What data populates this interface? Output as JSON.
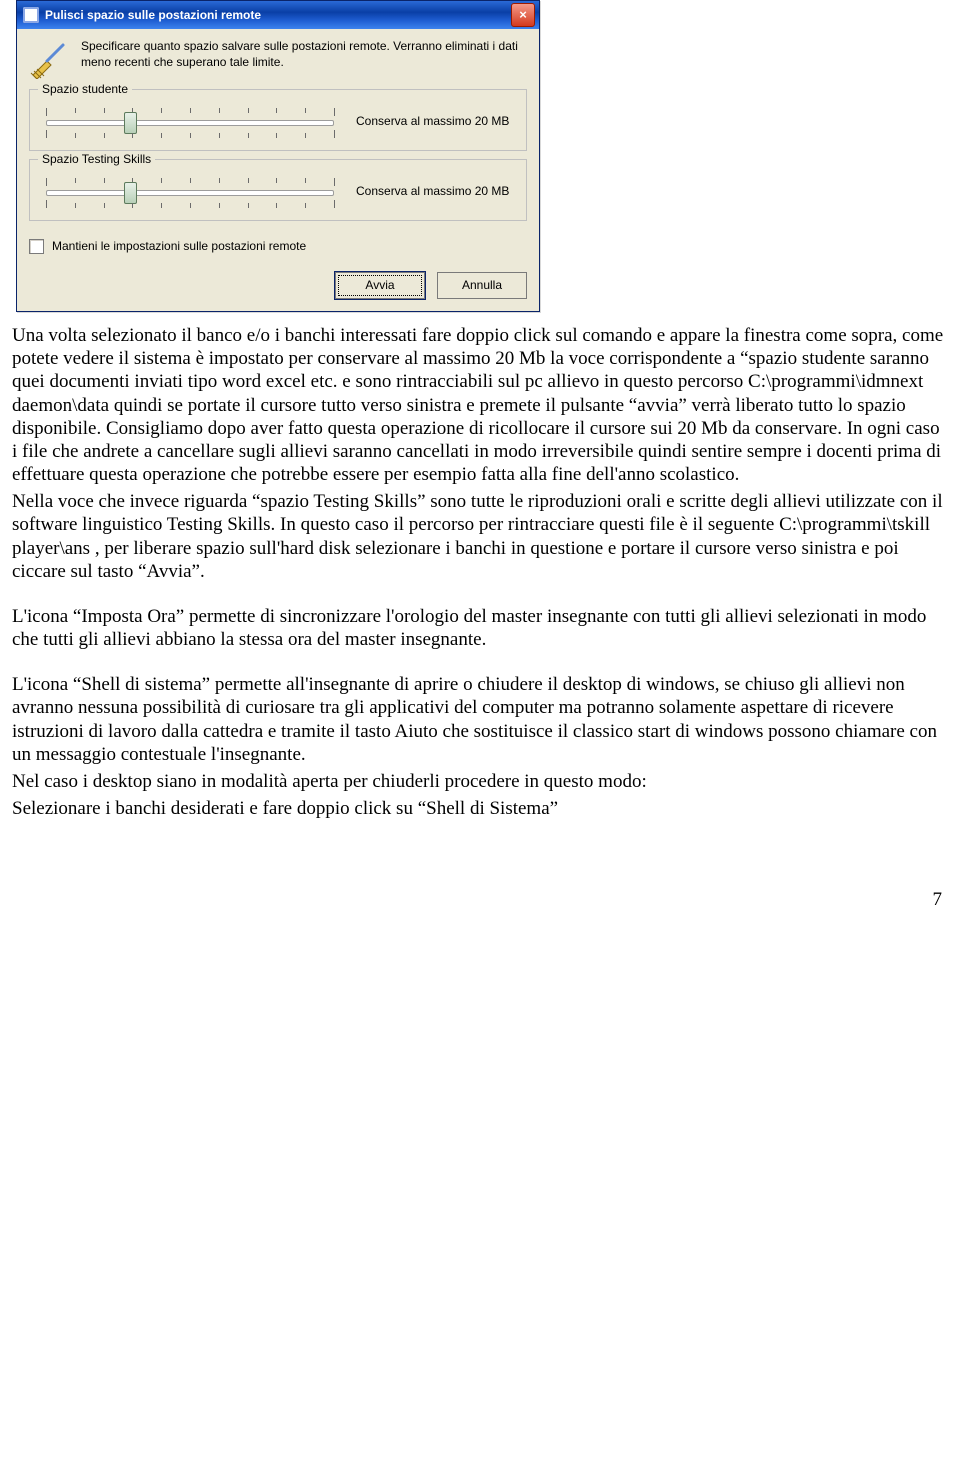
{
  "dialog": {
    "title": "Pulisci spazio sulle postazioni remote",
    "close": "×",
    "intro": "Specificare quanto spazio salvare sulle postazioni remote. Verranno eliminati i dati meno recenti che superano tale limite.",
    "group1": {
      "legend": "Spazio studente",
      "value_text": "Conserva al massimo 20 MB"
    },
    "group2": {
      "legend": "Spazio Testing Skills",
      "value_text": "Conserva al massimo 20 MB"
    },
    "keep_settings": "Mantieni le impostazioni sulle postazioni remote",
    "btn_start": "Avvia",
    "btn_cancel": "Annulla"
  },
  "doc": {
    "p1a": "Una volta selezionato il banco e/o i banchi interessati fare doppio click sul comando e appare la finestra come sopra, come potete vedere il sistema è impostato per conservare al massimo 20 Mb la voce corrispondente a “spazio studente saranno quei documenti inviati tipo word excel etc. e sono rintracciabili sul pc allievo in questo percorso C:\\programmi\\idmnext daemon\\data quindi se portate il cursore tutto verso sinistra e premete il pulsante “avvia” verrà liberato tutto lo spazio disponibile. Consigliamo dopo aver fatto questa operazione di ricollocare il cursore sui 20 Mb da conservare. In ogni caso i file che andrete a cancellare sugli allievi saranno cancellati in modo irreversibile quindi sentire sempre i docenti prima di effettuare questa operazione che potrebbe essere per esempio fatta alla fine dell'anno scolastico.",
    "p1b": "Nella voce che invece riguarda “spazio Testing Skills” sono tutte le riproduzioni orali e scritte degli allievi utilizzate con il software linguistico Testing Skills. In questo caso il percorso per rintracciare questi file è il seguente C:\\programmi\\tskill player\\ans , per liberare spazio sull'hard disk selezionare i banchi in questione e portare il cursore verso sinistra e poi ciccare sul tasto “Avvia”.",
    "p2": "L'icona “Imposta Ora” permette di sincronizzare l'orologio del master insegnante con tutti gli allievi selezionati in modo che tutti gli allievi abbiano la stessa ora del master insegnante.",
    "p3a": "L'icona “Shell di sistema” permette all'insegnante di aprire o chiudere il desktop di windows, se chiuso gli allievi non avranno nessuna possibilità di curiosare tra gli applicativi del computer ma potranno solamente aspettare di ricevere istruzioni di lavoro dalla cattedra e tramite il tasto Aiuto che sostituisce il classico start di windows possono chiamare con un messaggio contestuale l'insegnante.",
    "p3b": "Nel caso i desktop siano in modalità aperta per chiuderli procedere in questo modo:",
    "p3c": "Selezionare i banchi desiderati e fare doppio click su “Shell di Sistema”"
  },
  "page_number": "7"
}
